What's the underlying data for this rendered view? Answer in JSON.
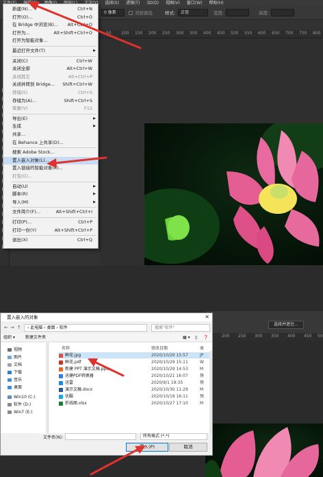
{
  "ps_menubar": [
    "文件(F)",
    "编辑(E)",
    "图像(I)",
    "图层(L)",
    "文字(Y)",
    "选择(S)",
    "滤镜(T)",
    "3D(D)",
    "视图(V)",
    "窗口(W)",
    "帮助(H)"
  ],
  "options_bar": {
    "feather": "0 像素",
    "antialias": "消除锯齿",
    "style_label": "样式:",
    "style_value": "正常",
    "width_label": "宽度:",
    "height_label": "高度:"
  },
  "ruler_top": [
    "50",
    "100",
    "150",
    "200",
    "250",
    "300",
    "350",
    "400",
    "450",
    "500",
    "550",
    "600",
    "650",
    "700",
    "750",
    "800"
  ],
  "file_menu": {
    "items": [
      {
        "label": "新建(N)...",
        "shortcut": "Ctrl+N",
        "disabled": false
      },
      {
        "label": "打开(O)...",
        "shortcut": "Ctrl+O",
        "disabled": false
      },
      {
        "label": "在 Bridge 中浏览(B)...",
        "shortcut": "Alt+Ctrl+O",
        "disabled": false
      },
      {
        "label": "打开为...",
        "shortcut": "Alt+Shift+Ctrl+O",
        "disabled": false
      },
      {
        "label": "打开为智能对象...",
        "shortcut": "",
        "disabled": false
      },
      {
        "label": "最近打开文件(T)",
        "shortcut": "",
        "disabled": false,
        "submenu": true
      },
      {
        "label": "关闭(C)",
        "shortcut": "Ctrl+W",
        "disabled": false
      },
      {
        "label": "关闭全部",
        "shortcut": "Alt+Ctrl+W",
        "disabled": false
      },
      {
        "label": "关闭其它",
        "shortcut": "Alt+Ctrl+P",
        "disabled": true
      },
      {
        "label": "关闭并转到 Bridge...",
        "shortcut": "Shift+Ctrl+W",
        "disabled": false
      },
      {
        "label": "存储(S)",
        "shortcut": "Ctrl+S",
        "disabled": true
      },
      {
        "label": "存储为(A)...",
        "shortcut": "Shift+Ctrl+S",
        "disabled": false
      },
      {
        "label": "恢复(V)",
        "shortcut": "F12",
        "disabled": true
      },
      {
        "label": "导出(E)",
        "shortcut": "",
        "disabled": false,
        "submenu": true
      },
      {
        "label": "生成",
        "shortcut": "",
        "disabled": false,
        "submenu": true
      },
      {
        "label": "共享...",
        "shortcut": "",
        "disabled": false
      },
      {
        "label": "在 Behance 上共享(D)...",
        "shortcut": "",
        "disabled": false
      },
      {
        "label": "搜索 Adobe Stock...",
        "shortcut": "",
        "disabled": false
      },
      {
        "label": "置入嵌入对象(L)...",
        "shortcut": "",
        "disabled": false,
        "highlight": true
      },
      {
        "label": "置入链接的智能对象(K)...",
        "shortcut": "",
        "disabled": false
      },
      {
        "label": "打包(G)...",
        "shortcut": "",
        "disabled": true
      },
      {
        "label": "自动(U)",
        "shortcut": "",
        "disabled": false,
        "submenu": true
      },
      {
        "label": "脚本(R)",
        "shortcut": "",
        "disabled": false,
        "submenu": true
      },
      {
        "label": "导入(M)",
        "shortcut": "",
        "disabled": false,
        "submenu": true
      },
      {
        "label": "文件简介(F)...",
        "shortcut": "Alt+Shift+Ctrl+I",
        "disabled": false
      },
      {
        "label": "打印(P)...",
        "shortcut": "Ctrl+P",
        "disabled": false
      },
      {
        "label": "打印一份(Y)",
        "shortcut": "Alt+Shift+Ctrl+P",
        "disabled": false
      },
      {
        "label": "退出(X)",
        "shortcut": "Ctrl+Q",
        "disabled": false
      }
    ]
  },
  "dialog": {
    "title": "置入嵌入的对象",
    "close": "✕",
    "address": "› 此电脑 › 桌面 › 软件",
    "search_placeholder": "搜索\"软件\"",
    "organize": "组织 ▾",
    "new_folder": "新建文件夹",
    "nav": [
      "视频",
      "图片",
      "文档",
      "下载",
      "音乐",
      "桌面",
      "Win10 (C:)",
      "软件 (D:)",
      "Win7 (E:)"
    ],
    "col_name": "名称",
    "col_date": "修改日期",
    "col_type": "类",
    "files": [
      {
        "name": "鲜花.jpg",
        "date": "2020/10/29 15:57",
        "type": "JP",
        "selected": true
      },
      {
        "name": "鲜花.pdf",
        "date": "2020/10/29 15:11",
        "type": "W"
      },
      {
        "name": "新建 PPT 演示文稿.pptx",
        "date": "2020/10/29 14:53",
        "type": "M"
      },
      {
        "name": "迅捷PDF转换器",
        "date": "2020/10/21 16:07",
        "type": "快"
      },
      {
        "name": "迅雷",
        "date": "2020/9/1 19:35",
        "type": "快"
      },
      {
        "name": "演示文稿.docx",
        "date": "2020/10/30 11:29",
        "type": "M"
      },
      {
        "name": "优酷",
        "date": "2020/10/19 16:11",
        "type": "快"
      },
      {
        "name": "折线图.xlsx",
        "date": "2020/10/27 17:10",
        "type": "M"
      }
    ],
    "filename_label": "文件名(N):",
    "filetype_value": "所有格式 (*.*)",
    "place_button": "置入(P)",
    "cancel_button": "取消"
  },
  "ps2": {
    "select_subject": "选择并遮住...",
    "ruler": [
      "200",
      "250",
      "300",
      "350",
      "400",
      "450",
      "500"
    ]
  },
  "colors": {
    "accent_red": "#e0322d",
    "highlight": "#c7dcf3",
    "selected_row": "#cce4f7"
  }
}
